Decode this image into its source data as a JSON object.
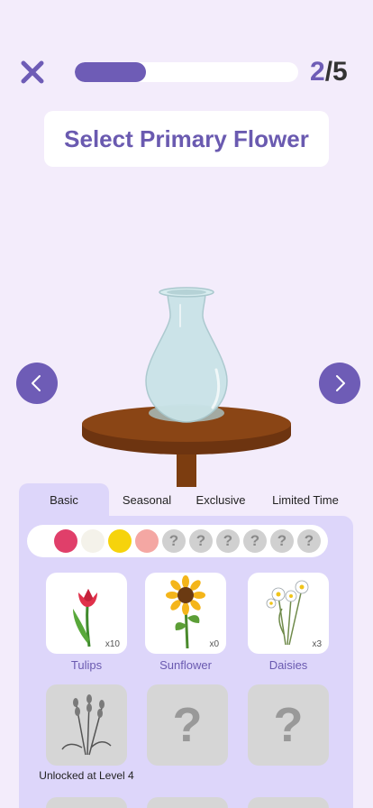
{
  "header": {
    "close_icon": "close-icon",
    "progress_fraction": 0.32,
    "step_current": "2",
    "step_total": "/5"
  },
  "title": "Select Primary Flower",
  "nav": {
    "prev_icon": "chevron-left-icon",
    "next_icon": "chevron-right-icon"
  },
  "colors": {
    "accent": "#6e5cb6",
    "panel": "#ddd6fa",
    "background": "#f3ecfb",
    "label": "#6a5ab0"
  },
  "tabs": [
    {
      "label": "Basic",
      "active": true
    },
    {
      "label": "Seasonal",
      "active": false
    },
    {
      "label": "Exclusive",
      "active": false
    },
    {
      "label": "Limited Time",
      "active": false
    }
  ],
  "swatches": [
    {
      "color": "#e03f6a",
      "locked": false
    },
    {
      "color": "#f4f2ea",
      "locked": false
    },
    {
      "color": "#f6d30c",
      "locked": false
    },
    {
      "color": "#f4a7a3",
      "locked": false
    },
    {
      "symbol": "?",
      "locked": true
    },
    {
      "symbol": "?",
      "locked": true
    },
    {
      "symbol": "?",
      "locked": true
    },
    {
      "symbol": "?",
      "locked": true
    },
    {
      "symbol": "?",
      "locked": true
    },
    {
      "symbol": "?",
      "locked": true
    }
  ],
  "flowers": [
    {
      "name": "Tulips",
      "qty": "x10",
      "icon": "tulip-icon"
    },
    {
      "name": "Sunflower",
      "qty": "x0",
      "icon": "sunflower-icon"
    },
    {
      "name": "Daisies",
      "qty": "x3",
      "icon": "daisies-icon"
    }
  ],
  "locked_cards": [
    {
      "icon": "lavender-icon",
      "label": "Unlocked at Level 4"
    },
    {
      "symbol": "?"
    },
    {
      "symbol": "?"
    }
  ]
}
